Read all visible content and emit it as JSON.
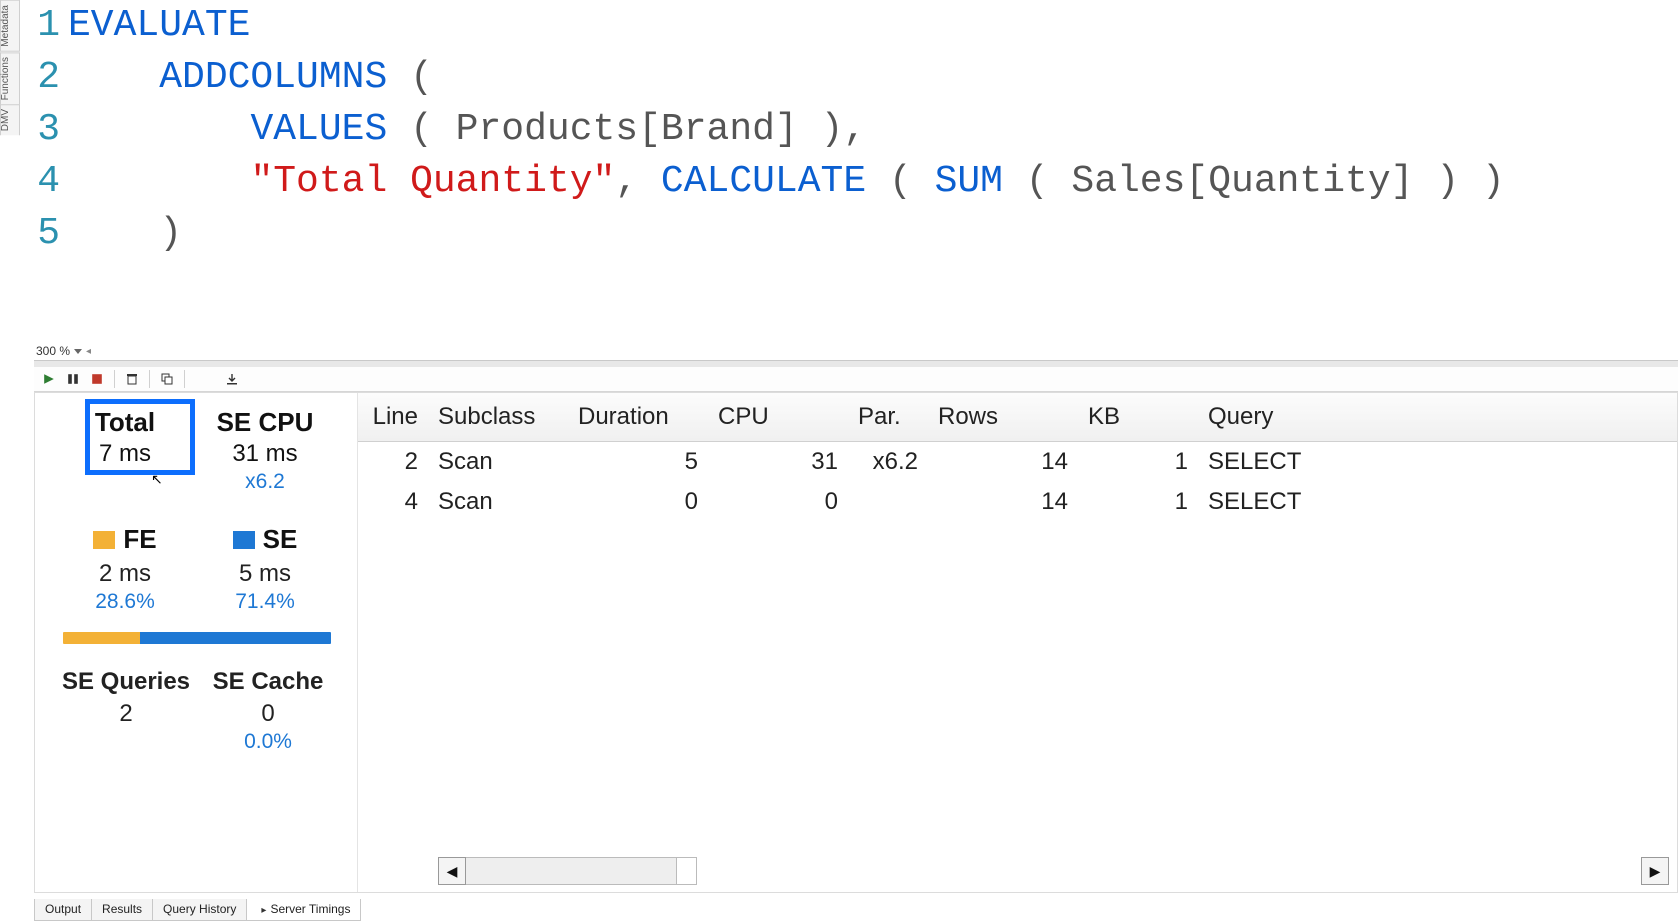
{
  "side_tabs": {
    "metadata": "Metadata",
    "functions": "Functions",
    "dmv": "DMV"
  },
  "editor": {
    "line_numbers": [
      "1",
      "2",
      "3",
      "4",
      "5"
    ],
    "lines": [
      [
        {
          "t": "EVALUATE",
          "c": "kw"
        }
      ],
      [
        {
          "t": "    ",
          "c": "plain"
        },
        {
          "t": "ADDCOLUMNS",
          "c": "kw"
        },
        {
          "t": " (",
          "c": "plain"
        }
      ],
      [
        {
          "t": "        ",
          "c": "plain"
        },
        {
          "t": "VALUES",
          "c": "kw"
        },
        {
          "t": " ( Products[Brand] ),",
          "c": "plain"
        }
      ],
      [
        {
          "t": "        ",
          "c": "plain"
        },
        {
          "t": "\"Total Quantity\"",
          "c": "str"
        },
        {
          "t": ", ",
          "c": "plain"
        },
        {
          "t": "CALCULATE",
          "c": "kw"
        },
        {
          "t": " ( ",
          "c": "plain"
        },
        {
          "t": "SUM",
          "c": "kw"
        },
        {
          "t": " ( Sales[Quantity] ) )",
          "c": "plain"
        }
      ],
      [
        {
          "t": "    )",
          "c": "plain"
        }
      ]
    ]
  },
  "zoom": {
    "level": "300 %"
  },
  "stats": {
    "total": {
      "label": "Total",
      "value": "7 ms"
    },
    "se_cpu": {
      "label": "SE CPU",
      "value": "31 ms",
      "sub": "x6.2"
    },
    "fe": {
      "label": "FE",
      "value": "2 ms",
      "sub": "28.6%"
    },
    "se": {
      "label": "SE",
      "value": "5 ms",
      "sub": "71.4%"
    },
    "bar": {
      "fe_pct": 28.6,
      "se_pct": 71.4
    },
    "se_queries": {
      "label": "SE Queries",
      "value": "2"
    },
    "se_cache": {
      "label": "SE Cache",
      "value": "0",
      "sub": "0.0%"
    }
  },
  "timing_table": {
    "columns": {
      "line": "Line",
      "subclass": "Subclass",
      "duration": "Duration",
      "cpu": "CPU",
      "par": "Par.",
      "rows": "Rows",
      "kb": "KB",
      "query": "Query"
    },
    "rows": [
      {
        "line": "2",
        "subclass": "Scan",
        "duration": "5",
        "cpu": "31",
        "par": "x6.2",
        "rows": "14",
        "kb": "1",
        "query": "SELECT"
      },
      {
        "line": "4",
        "subclass": "Scan",
        "duration": "0",
        "cpu": "0",
        "par": "",
        "rows": "14",
        "kb": "1",
        "query": "SELECT"
      }
    ]
  },
  "bottom_tabs": {
    "output": "Output",
    "results": "Results",
    "history": "Query History",
    "timings": "Server Timings"
  },
  "colors": {
    "fe": "#f3b136",
    "se": "#1e78d4",
    "highlight": "#0d6efd"
  }
}
